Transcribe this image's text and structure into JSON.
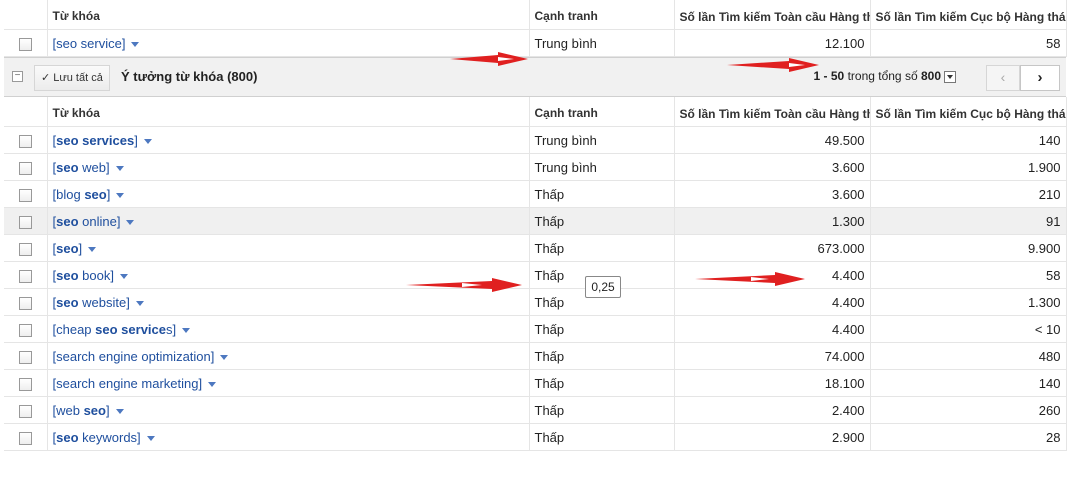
{
  "columns": {
    "keyword": "Từ khóa",
    "competition": "Cạnh tranh",
    "global": "Số lần Tìm kiếm Toàn cầu Hàng tháng",
    "local": "Số lần Tìm kiếm Cục bộ Hàng tháng",
    "help": "?"
  },
  "search_terms": [
    {
      "keyword": "[seo service]",
      "competition": "Trung bình",
      "global": "12.100",
      "local": "58"
    }
  ],
  "toolbar": {
    "collapse_symbol": "⊟",
    "save_all_label": "Lưu tất cả",
    "group_title": "Ý tưởng từ khóa (800)",
    "pager_range": "1 - 50",
    "pager_middle": "trong tổng số",
    "pager_total": "800",
    "prev": "‹",
    "next": "›"
  },
  "ideas": [
    {
      "kw_pre": "[",
      "kw_bold": "seo services",
      "kw_post": "]",
      "competition": "Trung bình",
      "global": "49.500",
      "local": "140"
    },
    {
      "kw_pre": "[",
      "kw_bold": "seo",
      "kw_post": " web]",
      "competition": "Trung bình",
      "global": "3.600",
      "local": "1.900"
    },
    {
      "kw_pre": "[blog ",
      "kw_bold": "seo",
      "kw_post": "]",
      "competition": "Thấp",
      "global": "3.600",
      "local": "210"
    },
    {
      "kw_pre": "[",
      "kw_bold": "seo",
      "kw_post": " online]",
      "competition": "Thấp",
      "global": "1.300",
      "local": "91"
    },
    {
      "kw_pre": "[",
      "kw_bold": "seo",
      "kw_post": "]",
      "competition": "Thấp",
      "global": "673.000",
      "local": "9.900"
    },
    {
      "kw_pre": "[",
      "kw_bold": "seo",
      "kw_post": " book]",
      "competition": "Thấp",
      "global": "4.400",
      "local": "58"
    },
    {
      "kw_pre": "[",
      "kw_bold": "seo",
      "kw_post": " website]",
      "competition": "Thấp",
      "global": "4.400",
      "local": "1.300"
    },
    {
      "kw_pre": "[cheap ",
      "kw_bold": "seo service",
      "kw_post": "s]",
      "competition": "Thấp",
      "global": "4.400",
      "local": "< 10"
    },
    {
      "kw_pre": "[search engine optimization]",
      "kw_bold": "",
      "kw_post": "",
      "competition": "Thấp",
      "global": "74.000",
      "local": "480"
    },
    {
      "kw_pre": "[search engine marketing]",
      "kw_bold": "",
      "kw_post": "",
      "competition": "Thấp",
      "global": "18.100",
      "local": "140"
    },
    {
      "kw_pre": "[web ",
      "kw_bold": "seo",
      "kw_post": "]",
      "competition": "Thấp",
      "global": "2.400",
      "local": "260"
    },
    {
      "kw_pre": "[",
      "kw_bold": "seo",
      "kw_post": " keywords]",
      "competition": "Thấp",
      "global": "2.900",
      "local": "28"
    }
  ],
  "tooltip_value": "0,25",
  "colors": {
    "link": "#1f4f9e",
    "annotation_arrow": "#e02020"
  }
}
